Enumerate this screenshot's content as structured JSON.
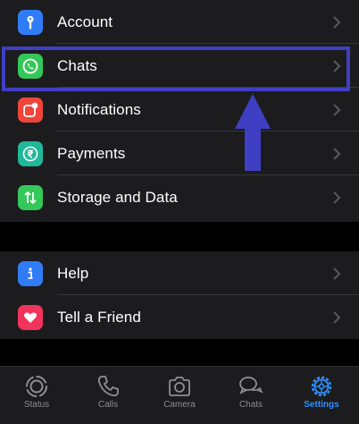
{
  "settings": {
    "group1": [
      {
        "label": "Account",
        "icon": "key-icon",
        "color": "#2f7cf6"
      },
      {
        "label": "Chats",
        "icon": "whatsapp-icon",
        "color": "#34c759"
      },
      {
        "label": "Notifications",
        "icon": "notification-icon",
        "color": "#f0453a"
      },
      {
        "label": "Payments",
        "icon": "rupee-icon",
        "color": "#1fb89a"
      },
      {
        "label": "Storage and Data",
        "icon": "storage-arrows-icon",
        "color": "#34c759"
      }
    ],
    "group2": [
      {
        "label": "Help",
        "icon": "info-icon",
        "color": "#2f7cf6"
      },
      {
        "label": "Tell a Friend",
        "icon": "heart-icon",
        "color": "#f2345d"
      }
    ]
  },
  "highlight": {
    "target": "Chats",
    "color": "#3f3fc4"
  },
  "tabs": [
    {
      "label": "Status",
      "icon": "status-icon",
      "active": false
    },
    {
      "label": "Calls",
      "icon": "phone-icon",
      "active": false
    },
    {
      "label": "Camera",
      "icon": "camera-icon",
      "active": false
    },
    {
      "label": "Chats",
      "icon": "chat-bubbles-icon",
      "active": false
    },
    {
      "label": "Settings",
      "icon": "gear-icon",
      "active": true
    }
  ],
  "colors": {
    "accent": "#2f8fff",
    "inactive": "#8e8e93",
    "background": "#000000",
    "surface": "#1c1c1e"
  }
}
